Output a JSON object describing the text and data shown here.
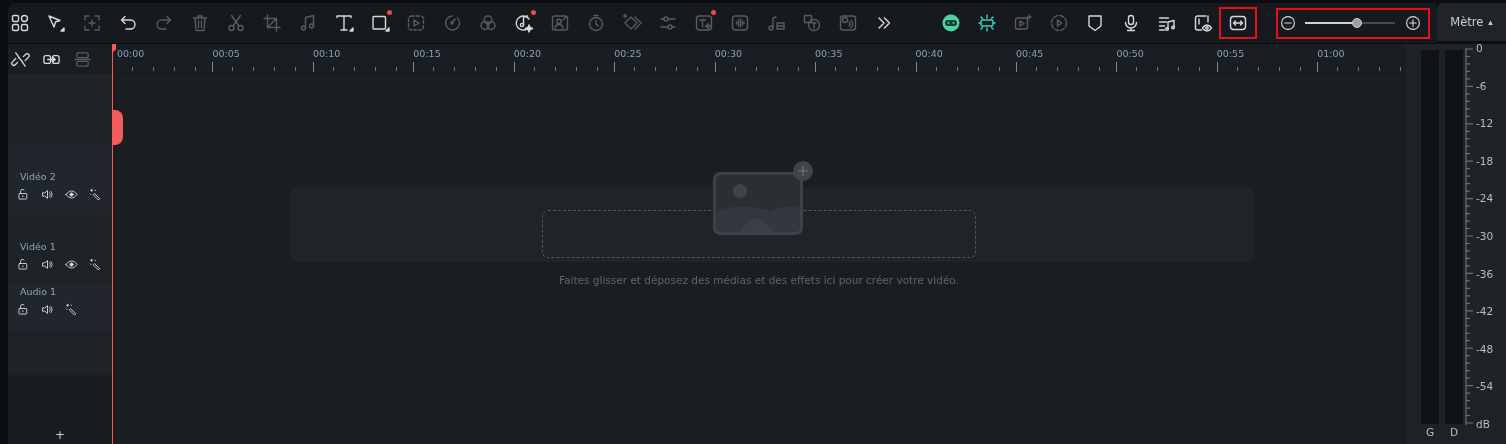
{
  "toolbar": {
    "tools": [
      {
        "kind": "grid",
        "disabled": false,
        "dot": false
      },
      {
        "kind": "select",
        "disabled": false,
        "dot": false
      },
      {
        "kind": "addframe",
        "disabled": true,
        "dot": false
      },
      {
        "kind": "undo",
        "disabled": false,
        "dot": false
      },
      {
        "kind": "redo",
        "disabled": true,
        "dot": false
      },
      {
        "kind": "trash",
        "disabled": true,
        "dot": false
      },
      {
        "kind": "scissors",
        "disabled": true,
        "dot": false
      },
      {
        "kind": "crop",
        "disabled": true,
        "dot": false
      },
      {
        "kind": "music",
        "disabled": true,
        "dot": false
      },
      {
        "kind": "text",
        "disabled": false,
        "dot": false
      },
      {
        "kind": "square",
        "disabled": false,
        "dot": true
      },
      {
        "kind": "mask",
        "disabled": true,
        "dot": false
      },
      {
        "kind": "speed",
        "disabled": true,
        "dot": false
      },
      {
        "kind": "circles",
        "disabled": true,
        "dot": false
      },
      {
        "kind": "aimusic",
        "disabled": false,
        "dot": true
      },
      {
        "kind": "portrait",
        "disabled": true,
        "dot": false
      },
      {
        "kind": "timer",
        "disabled": true,
        "dot": false
      },
      {
        "kind": "keyframe",
        "disabled": true,
        "dot": false
      },
      {
        "kind": "sliders",
        "disabled": true,
        "dot": false
      },
      {
        "kind": "textai",
        "disabled": true,
        "dot": true
      },
      {
        "kind": "wave",
        "disabled": true,
        "dot": false
      },
      {
        "kind": "stretch",
        "disabled": true,
        "dot": false
      },
      {
        "kind": "translate",
        "disabled": true,
        "dot": false
      },
      {
        "kind": "voice",
        "disabled": true,
        "dot": false
      },
      {
        "kind": "more",
        "disabled": false,
        "dot": false
      }
    ],
    "right_tools": [
      {
        "kind": "robot",
        "disabled": false,
        "highlighted": false
      },
      {
        "kind": "snap",
        "disabled": false,
        "highlighted": false
      },
      {
        "kind": "videoadd",
        "disabled": true,
        "highlighted": false
      },
      {
        "kind": "playcircle",
        "disabled": true,
        "highlighted": false
      },
      {
        "kind": "shield",
        "disabled": false,
        "highlighted": false
      },
      {
        "kind": "mic",
        "disabled": false,
        "highlighted": false
      },
      {
        "kind": "playlist",
        "disabled": false,
        "highlighted": false
      },
      {
        "kind": "preview",
        "disabled": false,
        "highlighted": false
      },
      {
        "kind": "fit",
        "disabled": false,
        "highlighted": true
      }
    ],
    "zoom": {
      "level": 0.58,
      "highlighted": true
    }
  },
  "meter_button": {
    "label": "Mètre",
    "caret": "▴"
  },
  "ruler": {
    "tools": [
      {
        "kind": "unlink",
        "disabled": false
      },
      {
        "kind": "link",
        "disabled": false
      },
      {
        "kind": "align",
        "disabled": true
      }
    ],
    "labels": [
      "00:00",
      "00:05",
      "00:10",
      "00:15",
      "00:20",
      "00:25",
      "00:30",
      "00:35",
      "00:40",
      "00:45",
      "00:50",
      "00:55",
      "01:00"
    ]
  },
  "tracks": [
    {
      "name": "Vidéo 2",
      "kind": "video",
      "controls": [
        {
          "kind": "lock"
        },
        {
          "kind": "speaker"
        },
        {
          "kind": "eye"
        },
        {
          "kind": "effects"
        }
      ]
    },
    {
      "name": "Vidéo 1",
      "kind": "video",
      "controls": [
        {
          "kind": "lock"
        },
        {
          "kind": "speaker"
        },
        {
          "kind": "eye"
        },
        {
          "kind": "effects"
        }
      ]
    },
    {
      "name": "Audio 1",
      "kind": "audio",
      "controls": [
        {
          "kind": "lock"
        },
        {
          "kind": "speaker"
        },
        {
          "kind": "effects"
        }
      ]
    }
  ],
  "add_track": "+",
  "drop_zone": {
    "hint": "Faites glisser et déposez des médias et des effets ici pour créer votre vidéo."
  },
  "meter": {
    "scale": [
      "0",
      "-6",
      "-12",
      "-18",
      "-24",
      "-30",
      "-36",
      "-42",
      "-48",
      "-54",
      "dB"
    ],
    "channels": [
      "G",
      "D"
    ]
  }
}
